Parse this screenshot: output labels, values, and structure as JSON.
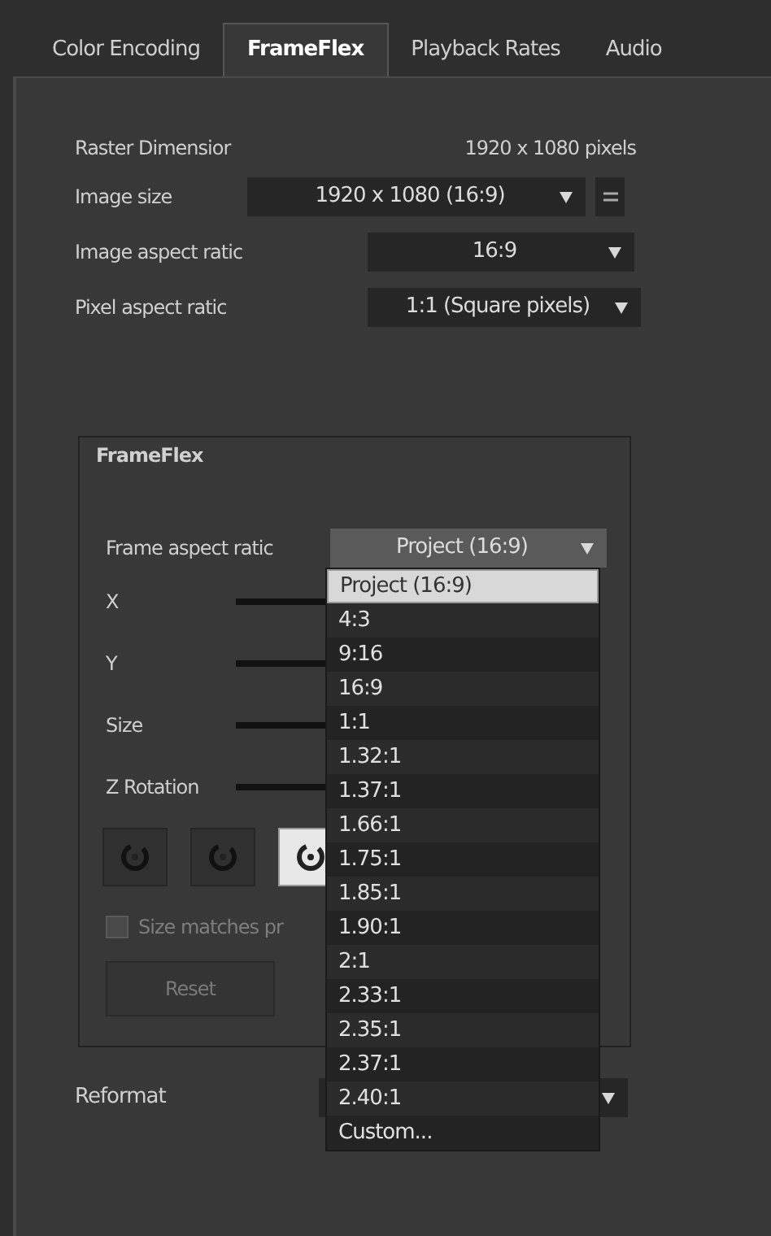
{
  "tabs": [
    {
      "label": "Color Encoding",
      "selected": false
    },
    {
      "label": "FrameFlex",
      "selected": true
    },
    {
      "label": "Playback Rates",
      "selected": false
    },
    {
      "label": "Audio",
      "selected": false
    }
  ],
  "raster": {
    "label": "Raster Dimensior",
    "value": "1920 x 1080 pixels"
  },
  "image_size": {
    "label": "Image size",
    "value": "1920 x 1080 (16:9)"
  },
  "image_aspect": {
    "label": "Image aspect ratic",
    "value": "16:9"
  },
  "pixel_aspect": {
    "label": "Pixel aspect ratic",
    "value": "1:1 (Square pixels)"
  },
  "frameflex": {
    "title": "FrameFlex",
    "frame_aspect": {
      "label": "Frame aspect ratic",
      "value": "Project (16:9)",
      "expanded": true
    },
    "sliders": [
      {
        "label": "X"
      },
      {
        "label": "Y"
      },
      {
        "label": "Size"
      },
      {
        "label": "Z Rotation"
      }
    ],
    "rotation_buttons": [
      {
        "selected": false
      },
      {
        "selected": false
      },
      {
        "selected": true
      }
    ],
    "size_matches": {
      "label": "Size matches pr",
      "checked": false,
      "disabled": true
    },
    "reset": "Reset"
  },
  "reformat": {
    "label": "Reformat"
  },
  "options": [
    {
      "label": "Project (16:9)",
      "selected": true
    },
    {
      "label": "4:3",
      "selected": false
    },
    {
      "label": "9:16",
      "selected": false
    },
    {
      "label": "16:9",
      "selected": false
    },
    {
      "label": "1:1",
      "selected": false
    },
    {
      "label": "1.32:1",
      "selected": false
    },
    {
      "label": "1.37:1",
      "selected": false
    },
    {
      "label": "1.66:1",
      "selected": false
    },
    {
      "label": "1.75:1",
      "selected": false
    },
    {
      "label": "1.85:1",
      "selected": false
    },
    {
      "label": "1.90:1",
      "selected": false
    },
    {
      "label": "2:1",
      "selected": false
    },
    {
      "label": "2.33:1",
      "selected": false
    },
    {
      "label": "2.35:1",
      "selected": false
    },
    {
      "label": "2.37:1",
      "selected": false
    },
    {
      "label": "2.40:1",
      "selected": false
    },
    {
      "label": "Custom...",
      "selected": false
    }
  ]
}
